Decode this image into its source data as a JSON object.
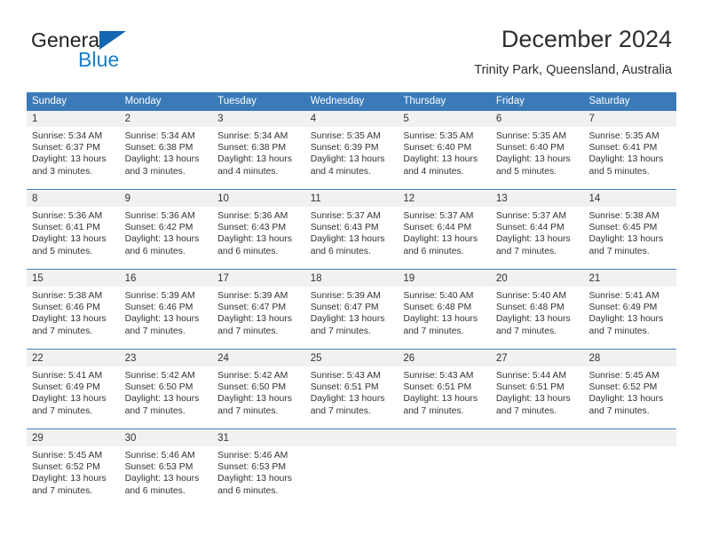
{
  "brand": {
    "name_top": "General",
    "name_bottom": "Blue",
    "triangle_color": "#1366b0",
    "blue_color": "#1a7ec8"
  },
  "header": {
    "title": "December 2024",
    "subtitle": "Trinity Park, Queensland, Australia"
  },
  "theme": {
    "header_blue": "#3a7ab8",
    "day_band_gray": "#f1f1f1",
    "text": "#333333"
  },
  "weekdays": [
    "Sunday",
    "Monday",
    "Tuesday",
    "Wednesday",
    "Thursday",
    "Friday",
    "Saturday"
  ],
  "weeks": [
    [
      {
        "day": "1",
        "sunrise": "Sunrise: 5:34 AM",
        "sunset": "Sunset: 6:37 PM",
        "daylight1": "Daylight: 13 hours",
        "daylight2": "and 3 minutes."
      },
      {
        "day": "2",
        "sunrise": "Sunrise: 5:34 AM",
        "sunset": "Sunset: 6:38 PM",
        "daylight1": "Daylight: 13 hours",
        "daylight2": "and 3 minutes."
      },
      {
        "day": "3",
        "sunrise": "Sunrise: 5:34 AM",
        "sunset": "Sunset: 6:38 PM",
        "daylight1": "Daylight: 13 hours",
        "daylight2": "and 4 minutes."
      },
      {
        "day": "4",
        "sunrise": "Sunrise: 5:35 AM",
        "sunset": "Sunset: 6:39 PM",
        "daylight1": "Daylight: 13 hours",
        "daylight2": "and 4 minutes."
      },
      {
        "day": "5",
        "sunrise": "Sunrise: 5:35 AM",
        "sunset": "Sunset: 6:40 PM",
        "daylight1": "Daylight: 13 hours",
        "daylight2": "and 4 minutes."
      },
      {
        "day": "6",
        "sunrise": "Sunrise: 5:35 AM",
        "sunset": "Sunset: 6:40 PM",
        "daylight1": "Daylight: 13 hours",
        "daylight2": "and 5 minutes."
      },
      {
        "day": "7",
        "sunrise": "Sunrise: 5:35 AM",
        "sunset": "Sunset: 6:41 PM",
        "daylight1": "Daylight: 13 hours",
        "daylight2": "and 5 minutes."
      }
    ],
    [
      {
        "day": "8",
        "sunrise": "Sunrise: 5:36 AM",
        "sunset": "Sunset: 6:41 PM",
        "daylight1": "Daylight: 13 hours",
        "daylight2": "and 5 minutes."
      },
      {
        "day": "9",
        "sunrise": "Sunrise: 5:36 AM",
        "sunset": "Sunset: 6:42 PM",
        "daylight1": "Daylight: 13 hours",
        "daylight2": "and 6 minutes."
      },
      {
        "day": "10",
        "sunrise": "Sunrise: 5:36 AM",
        "sunset": "Sunset: 6:43 PM",
        "daylight1": "Daylight: 13 hours",
        "daylight2": "and 6 minutes."
      },
      {
        "day": "11",
        "sunrise": "Sunrise: 5:37 AM",
        "sunset": "Sunset: 6:43 PM",
        "daylight1": "Daylight: 13 hours",
        "daylight2": "and 6 minutes."
      },
      {
        "day": "12",
        "sunrise": "Sunrise: 5:37 AM",
        "sunset": "Sunset: 6:44 PM",
        "daylight1": "Daylight: 13 hours",
        "daylight2": "and 6 minutes."
      },
      {
        "day": "13",
        "sunrise": "Sunrise: 5:37 AM",
        "sunset": "Sunset: 6:44 PM",
        "daylight1": "Daylight: 13 hours",
        "daylight2": "and 7 minutes."
      },
      {
        "day": "14",
        "sunrise": "Sunrise: 5:38 AM",
        "sunset": "Sunset: 6:45 PM",
        "daylight1": "Daylight: 13 hours",
        "daylight2": "and 7 minutes."
      }
    ],
    [
      {
        "day": "15",
        "sunrise": "Sunrise: 5:38 AM",
        "sunset": "Sunset: 6:46 PM",
        "daylight1": "Daylight: 13 hours",
        "daylight2": "and 7 minutes."
      },
      {
        "day": "16",
        "sunrise": "Sunrise: 5:39 AM",
        "sunset": "Sunset: 6:46 PM",
        "daylight1": "Daylight: 13 hours",
        "daylight2": "and 7 minutes."
      },
      {
        "day": "17",
        "sunrise": "Sunrise: 5:39 AM",
        "sunset": "Sunset: 6:47 PM",
        "daylight1": "Daylight: 13 hours",
        "daylight2": "and 7 minutes."
      },
      {
        "day": "18",
        "sunrise": "Sunrise: 5:39 AM",
        "sunset": "Sunset: 6:47 PM",
        "daylight1": "Daylight: 13 hours",
        "daylight2": "and 7 minutes."
      },
      {
        "day": "19",
        "sunrise": "Sunrise: 5:40 AM",
        "sunset": "Sunset: 6:48 PM",
        "daylight1": "Daylight: 13 hours",
        "daylight2": "and 7 minutes."
      },
      {
        "day": "20",
        "sunrise": "Sunrise: 5:40 AM",
        "sunset": "Sunset: 6:48 PM",
        "daylight1": "Daylight: 13 hours",
        "daylight2": "and 7 minutes."
      },
      {
        "day": "21",
        "sunrise": "Sunrise: 5:41 AM",
        "sunset": "Sunset: 6:49 PM",
        "daylight1": "Daylight: 13 hours",
        "daylight2": "and 7 minutes."
      }
    ],
    [
      {
        "day": "22",
        "sunrise": "Sunrise: 5:41 AM",
        "sunset": "Sunset: 6:49 PM",
        "daylight1": "Daylight: 13 hours",
        "daylight2": "and 7 minutes."
      },
      {
        "day": "23",
        "sunrise": "Sunrise: 5:42 AM",
        "sunset": "Sunset: 6:50 PM",
        "daylight1": "Daylight: 13 hours",
        "daylight2": "and 7 minutes."
      },
      {
        "day": "24",
        "sunrise": "Sunrise: 5:42 AM",
        "sunset": "Sunset: 6:50 PM",
        "daylight1": "Daylight: 13 hours",
        "daylight2": "and 7 minutes."
      },
      {
        "day": "25",
        "sunrise": "Sunrise: 5:43 AM",
        "sunset": "Sunset: 6:51 PM",
        "daylight1": "Daylight: 13 hours",
        "daylight2": "and 7 minutes."
      },
      {
        "day": "26",
        "sunrise": "Sunrise: 5:43 AM",
        "sunset": "Sunset: 6:51 PM",
        "daylight1": "Daylight: 13 hours",
        "daylight2": "and 7 minutes."
      },
      {
        "day": "27",
        "sunrise": "Sunrise: 5:44 AM",
        "sunset": "Sunset: 6:51 PM",
        "daylight1": "Daylight: 13 hours",
        "daylight2": "and 7 minutes."
      },
      {
        "day": "28",
        "sunrise": "Sunrise: 5:45 AM",
        "sunset": "Sunset: 6:52 PM",
        "daylight1": "Daylight: 13 hours",
        "daylight2": "and 7 minutes."
      }
    ],
    [
      {
        "day": "29",
        "sunrise": "Sunrise: 5:45 AM",
        "sunset": "Sunset: 6:52 PM",
        "daylight1": "Daylight: 13 hours",
        "daylight2": "and 7 minutes."
      },
      {
        "day": "30",
        "sunrise": "Sunrise: 5:46 AM",
        "sunset": "Sunset: 6:53 PM",
        "daylight1": "Daylight: 13 hours",
        "daylight2": "and 6 minutes."
      },
      {
        "day": "31",
        "sunrise": "Sunrise: 5:46 AM",
        "sunset": "Sunset: 6:53 PM",
        "daylight1": "Daylight: 13 hours",
        "daylight2": "and 6 minutes."
      },
      {
        "day": "",
        "sunrise": "",
        "sunset": "",
        "daylight1": "",
        "daylight2": ""
      },
      {
        "day": "",
        "sunrise": "",
        "sunset": "",
        "daylight1": "",
        "daylight2": ""
      },
      {
        "day": "",
        "sunrise": "",
        "sunset": "",
        "daylight1": "",
        "daylight2": ""
      },
      {
        "day": "",
        "sunrise": "",
        "sunset": "",
        "daylight1": "",
        "daylight2": ""
      }
    ]
  ]
}
